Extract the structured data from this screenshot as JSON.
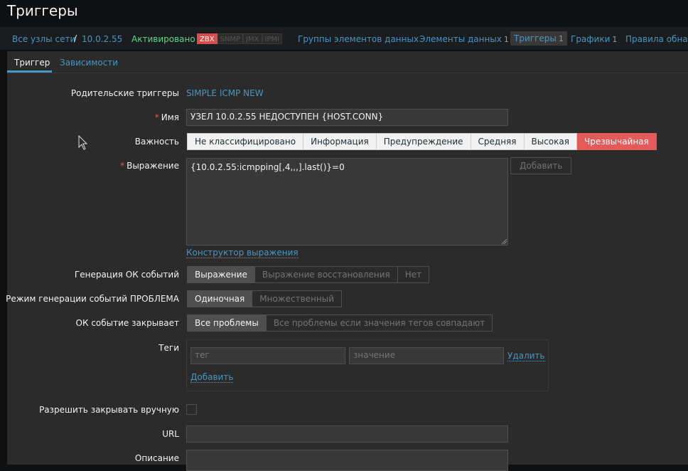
{
  "page": {
    "title": "Триггеры"
  },
  "breadcrumb": {
    "all_hosts": "Все узлы сети",
    "separator": "/",
    "host": "10.0.2.55"
  },
  "host_status": "Активировано",
  "availability": [
    "ZBX",
    "SNMP",
    "JMX",
    "IPMI"
  ],
  "nav": {
    "item_groups": "Группы элементов данных",
    "items": "Элементы данных",
    "items_count": "1",
    "triggers": "Триггеры",
    "triggers_count": "1",
    "graphs": "Графики",
    "graphs_count": "1",
    "discovery": "Правила обнар"
  },
  "tabs": {
    "trigger": "Триггер",
    "dependencies": "Зависимости"
  },
  "form": {
    "parent_label": "Родительские триггеры",
    "parent_value": "SIMPLE ICMP NEW",
    "name_label": "Имя",
    "name_value": "УЗЕЛ 10.0.2.55 НЕДОСТУПЕН {HOST.CONN}",
    "severity_label": "Важность",
    "severities": [
      "Не классифицировано",
      "Информация",
      "Предупреждение",
      "Средняя",
      "Высокая",
      "Чрезвычайная"
    ],
    "severity_selected": "Чрезвычайная",
    "expression_label": "Выражение",
    "expression_value": "{10.0.2.55:icmpping[,4,,,].last()}=0",
    "add_button": "Добавить",
    "expression_builder": "Конструктор выражения",
    "ok_gen_label": "Генерация ОК событий",
    "ok_gen_options": [
      "Выражение",
      "Выражение восстановления",
      "Нет"
    ],
    "problem_mode_label": "Режим генерации событий ПРОБЛЕМА",
    "problem_mode_options": [
      "Одиночная",
      "Множественный"
    ],
    "ok_closes_label": "ОК событие закрывает",
    "ok_closes_options": [
      "Все проблемы",
      "Все проблемы если значения тегов совпадают"
    ],
    "tags_label": "Теги",
    "tag_placeholder": "тег",
    "value_placeholder": "значение",
    "remove_link": "Удалить",
    "add_tag_link": "Добавить",
    "manual_close_label": "Разрешить закрывать вручную",
    "url_label": "URL",
    "description_label": "Описание"
  },
  "colors": {
    "accent": "#4796c4",
    "critical": "#e45959",
    "enabled": "#59db8f"
  }
}
